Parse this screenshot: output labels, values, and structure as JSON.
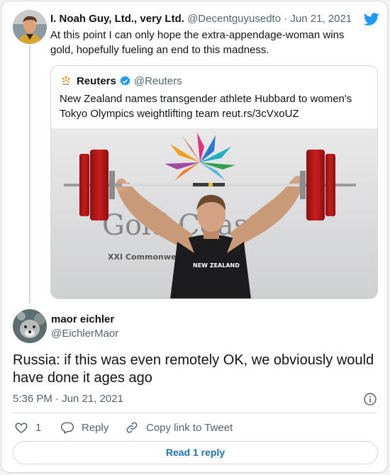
{
  "parent_tweet": {
    "author_name": "I. Noah Guy, Ltd., very Ltd.",
    "handle": "@Decentguyusedto",
    "separator": "·",
    "date": "Jun 21, 2021",
    "text": "At this point I can only hope the extra-appendage-woman wins gold, hopefully fueling an end to this madness."
  },
  "quoted_tweet": {
    "author_name": "Reuters",
    "handle": "@Reuters",
    "text": "New Zealand names transgender athlete Hubbard to women's Tokyo Olympics weightlifting team reut.rs/3cVxoUZ",
    "image_text": {
      "banner": "Gold Coast",
      "sub_banner": "XXI Commonwealth",
      "shirt": "NEW ZEALAND"
    }
  },
  "reply_tweet": {
    "author_name": "maor eichler",
    "handle": "@EichlerMaor",
    "text": "Russia: if this was even remotely OK, we obviously would have done it ages ago",
    "time": "5:36 PM",
    "separator": "·",
    "date": "Jun 21, 2021"
  },
  "actions": {
    "like_count": "1",
    "reply_label": "Reply",
    "copy_label": "Copy link to Tweet"
  },
  "read_replies_label": "Read 1 reply",
  "icons": [
    "twitter-bird-icon",
    "verified-badge-icon",
    "info-icon",
    "heart-icon",
    "reply-icon",
    "link-icon"
  ],
  "colors": {
    "twitter_blue": "#1d9bf0",
    "read_button_text": "#1d72b8",
    "secondary_text": "#536471",
    "border": "#cfd9de",
    "primary_text": "#0f1419"
  }
}
